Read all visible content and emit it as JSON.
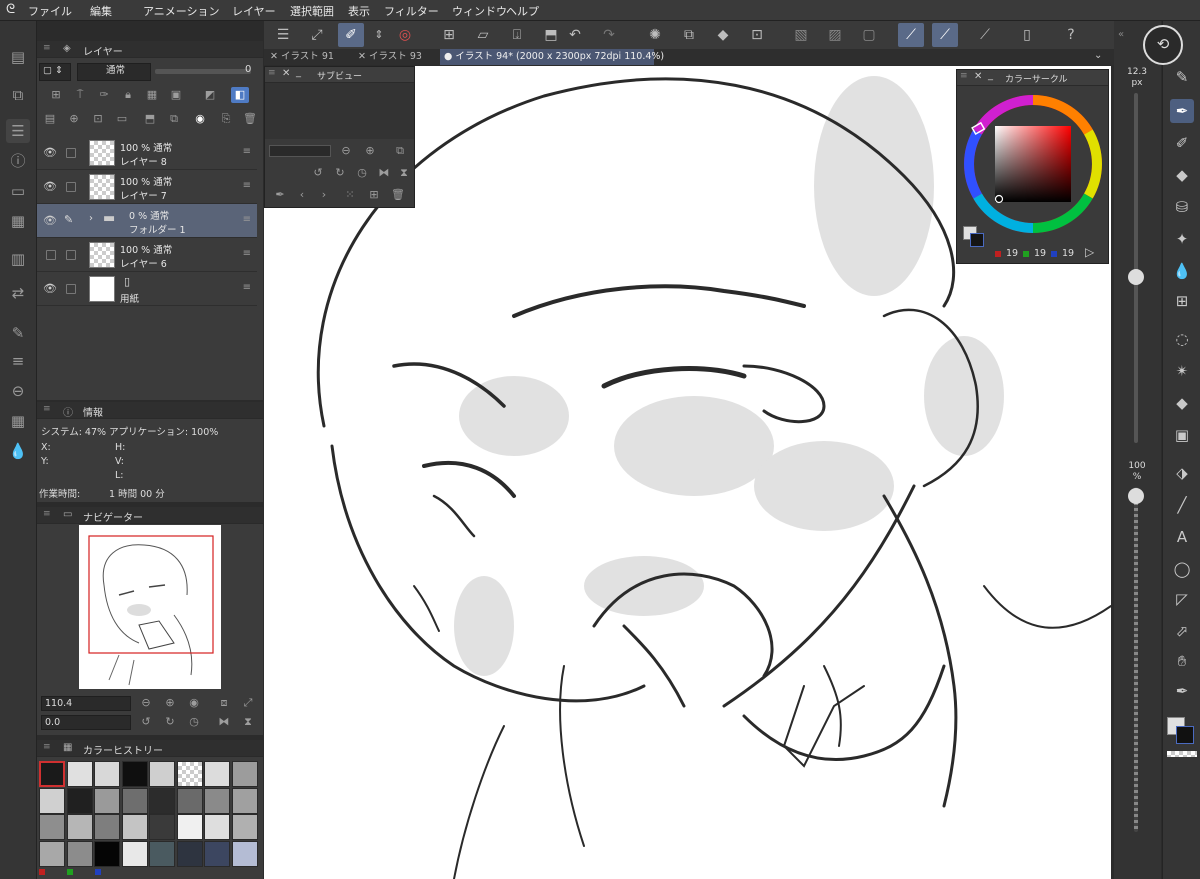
{
  "menu": [
    "ファイル",
    "編集",
    "アニメーション",
    "レイヤー",
    "選択範囲",
    "表示",
    "フィルター",
    "ウィンドウ",
    "ヘルプ"
  ],
  "layer_panel": {
    "title": "レイヤー",
    "blend_mode": "通常",
    "opacity_value": "0",
    "layers": [
      {
        "line1": "100 % 通常",
        "line2": "レイヤー 8",
        "visible": true,
        "thumb": "checker"
      },
      {
        "line1": "100 % 通常",
        "line2": "レイヤー 7",
        "visible": true,
        "thumb": "checker"
      },
      {
        "line1": "0 % 通常",
        "line2": "フォルダー 1",
        "visible": true,
        "thumb": "folder",
        "selected": true
      },
      {
        "line1": "100 % 通常",
        "line2": "レイヤー 6",
        "visible": false,
        "thumb": "checker"
      },
      {
        "line1": "",
        "line2": "用紙",
        "visible": true,
        "thumb": "white"
      }
    ]
  },
  "info_panel": {
    "title": "情報",
    "system": "システム: 47%  アプリケーション: 100%",
    "x": "X:",
    "y": "Y:",
    "h": "H:",
    "v": "V:",
    "l": "L:",
    "work_time_label": "作業時間:",
    "work_time_value": "1 時間 00 分"
  },
  "navigator": {
    "title": "ナビゲーター",
    "zoom": "110.4",
    "rotation": "0.0"
  },
  "color_history": {
    "title": "カラーヒストリー",
    "swatches": [
      "#1a1a1a",
      "#e0e0e0",
      "#d8d8d8",
      "#0f0f0f",
      "#cfcfcf",
      "checker",
      "#dcdcdc",
      "#9c9c9c",
      "#d0d0d0",
      "#202020",
      "#9a9a9a",
      "#6e6e6e",
      "#2c2c2c",
      "#6a6a6a",
      "#8a8a8a",
      "#a0a0a0",
      "#8e8e8e",
      "#b6b6b6",
      "#7e7e7e",
      "#c4c4c4",
      "#3a3a3a",
      "#f0f0f0",
      "#dedede",
      "#b0b0b0",
      "#a8a8a8",
      "#8c8c8c",
      "#050505",
      "#e8e8e8",
      "#4a5a60",
      "#2e3440",
      "#3c4660",
      "#b4bcd4"
    ]
  },
  "subview": {
    "title": "サブビュー"
  },
  "color_circle": {
    "title": "カラーサークル",
    "r": "19",
    "g": "19",
    "b": "19"
  },
  "tabs": [
    "イラスト 91",
    "イラスト 93",
    "イラスト 94* (2000 x 2300px 72dpi 110.4%)"
  ],
  "brush_size": {
    "value": "12.3",
    "unit": "px"
  },
  "brush_opacity": {
    "value": "100",
    "unit": "%"
  },
  "colors": {
    "accent": "#5a6a88",
    "selected_layer": "#5a6478",
    "navigator_frame": "#d42020"
  }
}
